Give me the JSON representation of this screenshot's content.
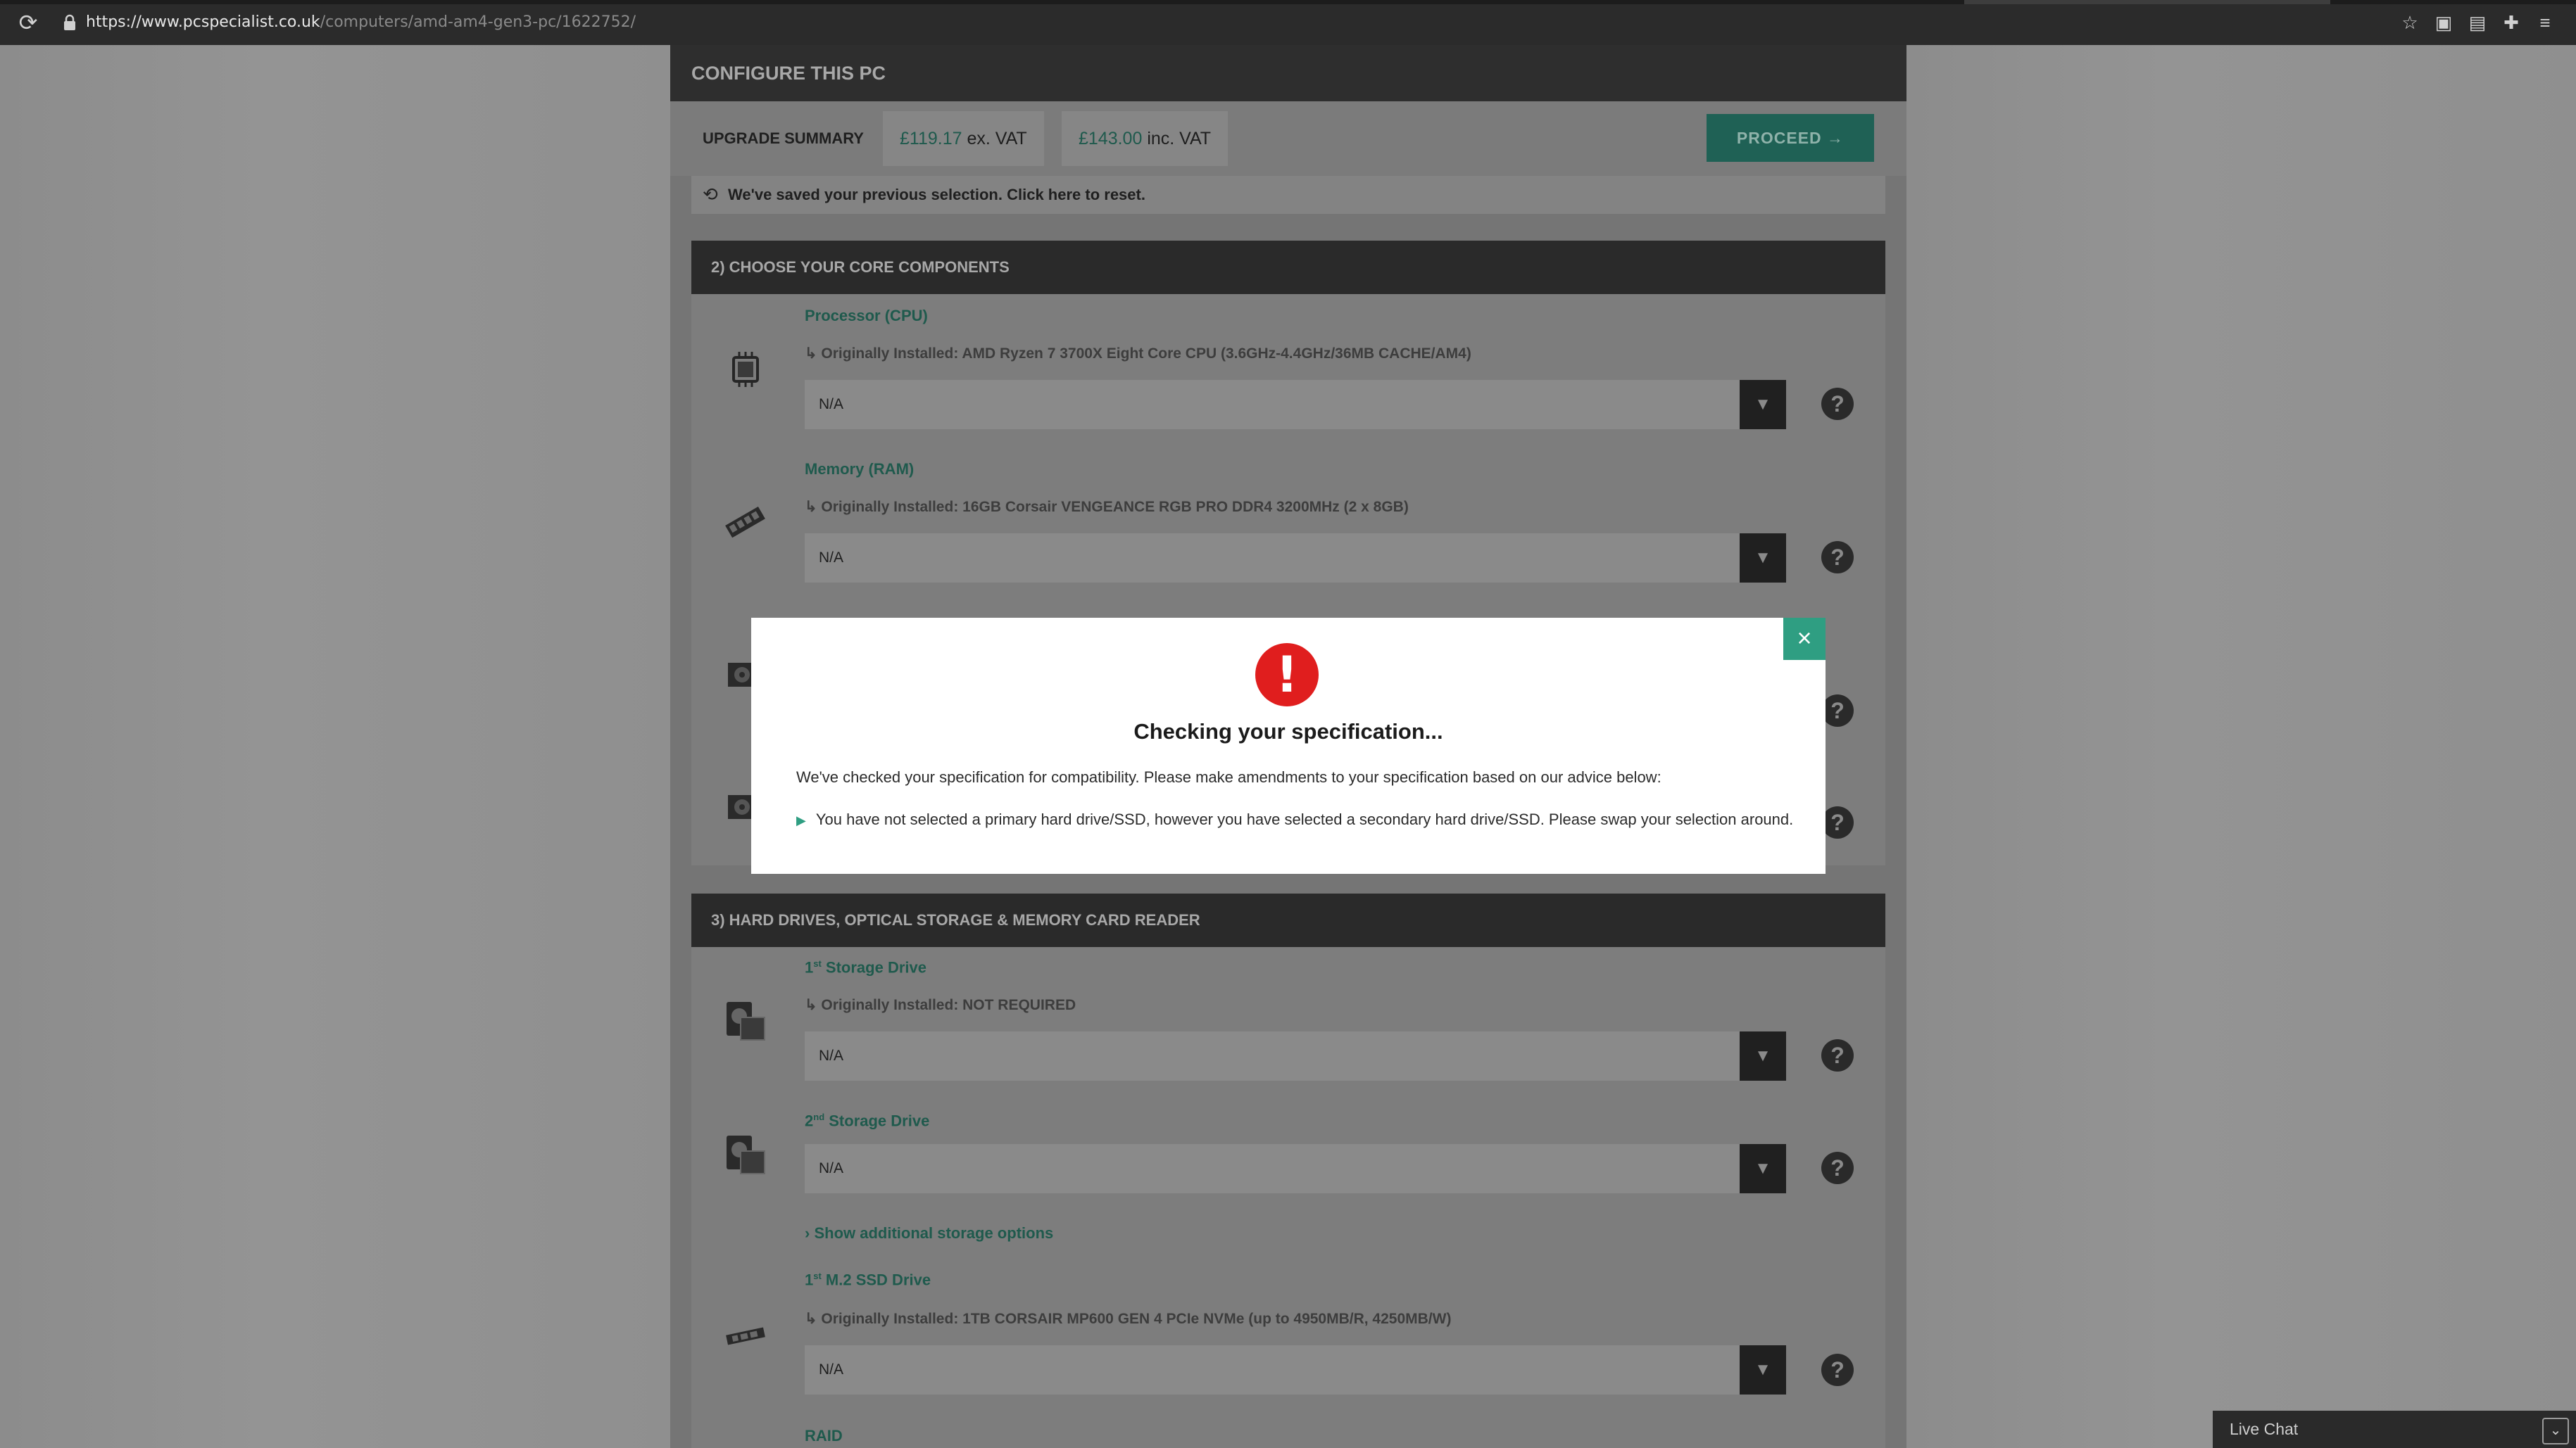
{
  "browser": {
    "url_host": "https://www.pcspecialist.co.uk",
    "url_path": "/computers/amd-am4-gen3-pc/1622752/",
    "reload_icon": "reload-icon",
    "toolbar_icons": [
      "star-icon",
      "extension-a-icon",
      "extension-b-icon",
      "puzzle-icon",
      "reading-list-icon"
    ]
  },
  "header": {
    "title": "CONFIGURE THIS PC"
  },
  "summary": {
    "label": "UPGRADE SUMMARY",
    "ex_vat_amount": "£119.17",
    "ex_vat_label": " ex. VAT",
    "inc_vat_amount": "£143.00",
    "inc_vat_label": " inc. VAT",
    "proceed_label": "PROCEED →"
  },
  "saved_notice": "We've saved your previous selection. Click here to reset.",
  "section2": {
    "title": "2) CHOOSE YOUR CORE COMPONENTS",
    "rows": [
      {
        "title": "Processor (CPU)",
        "sub": "↳ Originally Installed: AMD Ryzen 7 3700X Eight Core CPU (3.6GHz-4.4GHz/36MB CACHE/AM4)",
        "value": "N/A"
      },
      {
        "title": "Memory (RAM)",
        "sub": "↳ Originally Installed: 16GB Corsair VENGEANCE RGB PRO DDR4 3200MHz (2 x 8GB)",
        "value": "N/A"
      }
    ]
  },
  "section3": {
    "title": "3) HARD DRIVES, OPTICAL STORAGE & MEMORY CARD READER",
    "storage1": {
      "num": "1",
      "sup": "st",
      "title": " Storage Drive",
      "sub": "↳ Originally Installed: NOT REQUIRED",
      "value": "N/A"
    },
    "storage2": {
      "num": "2",
      "sup": "nd",
      "title": " Storage Drive",
      "value": "N/A"
    },
    "show_more": "Show additional storage options",
    "m2": {
      "num": "1",
      "sup": "st",
      "title": " M.2 SSD Drive",
      "sub": "↳ Originally Installed: 1TB CORSAIR MP600 GEN 4 PCIe NVMe (up to 4950MB/R, 4250MB/W)",
      "value": "N/A"
    },
    "raid_title": "RAID"
  },
  "help_glyph": "?",
  "select_arrow": "▼",
  "modal": {
    "alert_glyph": "!",
    "close_glyph": "×",
    "title": "Checking your specification...",
    "text": "We've checked your specification for compatibility. Please make amendments to your specification based on our advice below:",
    "bullet": "You have not selected a primary hard drive/SSD, however you have selected a secondary hard drive/SSD. Please swap your selection around."
  },
  "live_chat": {
    "label": "Live Chat"
  },
  "colors": {
    "accent": "#2f9e82",
    "alert": "#e01e1e"
  }
}
